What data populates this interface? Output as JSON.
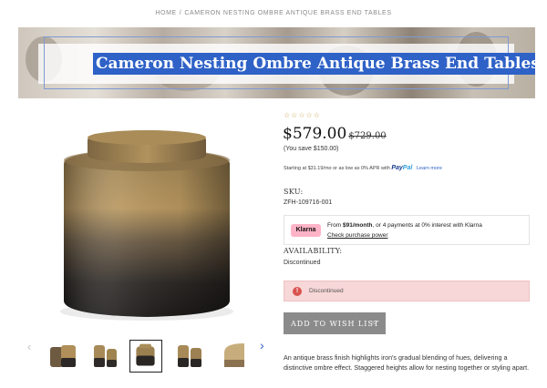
{
  "breadcrumb": {
    "home": "HOME",
    "separator": "/",
    "current": "CAMERON NESTING OMBRE ANTIQUE BRASS END TABLES"
  },
  "hero": {
    "title": "Cameron Nesting Ombre Antique Brass End Tables"
  },
  "gallery": {
    "prev_icon": "‹",
    "next_icon": "›",
    "selected_thumbnail": 3,
    "thumbnail_count": 5
  },
  "product": {
    "rating_stars": "☆☆☆☆☆",
    "rating_value": 0,
    "price": "$579.00",
    "original_price": "$729.00",
    "savings": "(You save $150.00)",
    "financing": {
      "text": "Starting at $31.19/mo or as low as 0% APR with",
      "brand_pay": "Pay",
      "brand_pal": "Pal",
      "link": "Learn more"
    },
    "sku_label": "SKU:",
    "sku_value": "ZFH-109716-001",
    "klarna": {
      "badge": "Klarna",
      "text_prefix": "From",
      "amount": "$91/month",
      "text_suffix": ", or 4 payments at 0% interest with Klarna",
      "link": "Check purchase power"
    },
    "availability_label": "AVAILABILITY:",
    "availability_value": "Discontinued",
    "alert": {
      "icon": "!",
      "text": "Discontinued"
    },
    "wishlist_button": "ADD TO WISH LIST",
    "wishlist_chevron": "⌵",
    "description": "An antique brass finish highlights iron's gradual blending of hues, delivering a distinctive ombre effect. Staggered heights allow for nesting together or styling apart."
  },
  "colors": {
    "accent": "#2f62c7",
    "klarna_pink": "#ffb3c7",
    "alert_bg": "#f7d7d8",
    "alert_icon": "#d9534f",
    "button_gray": "#8b8b8b",
    "brass_top": "#a3875a",
    "brass_dark": "#2a2623"
  }
}
